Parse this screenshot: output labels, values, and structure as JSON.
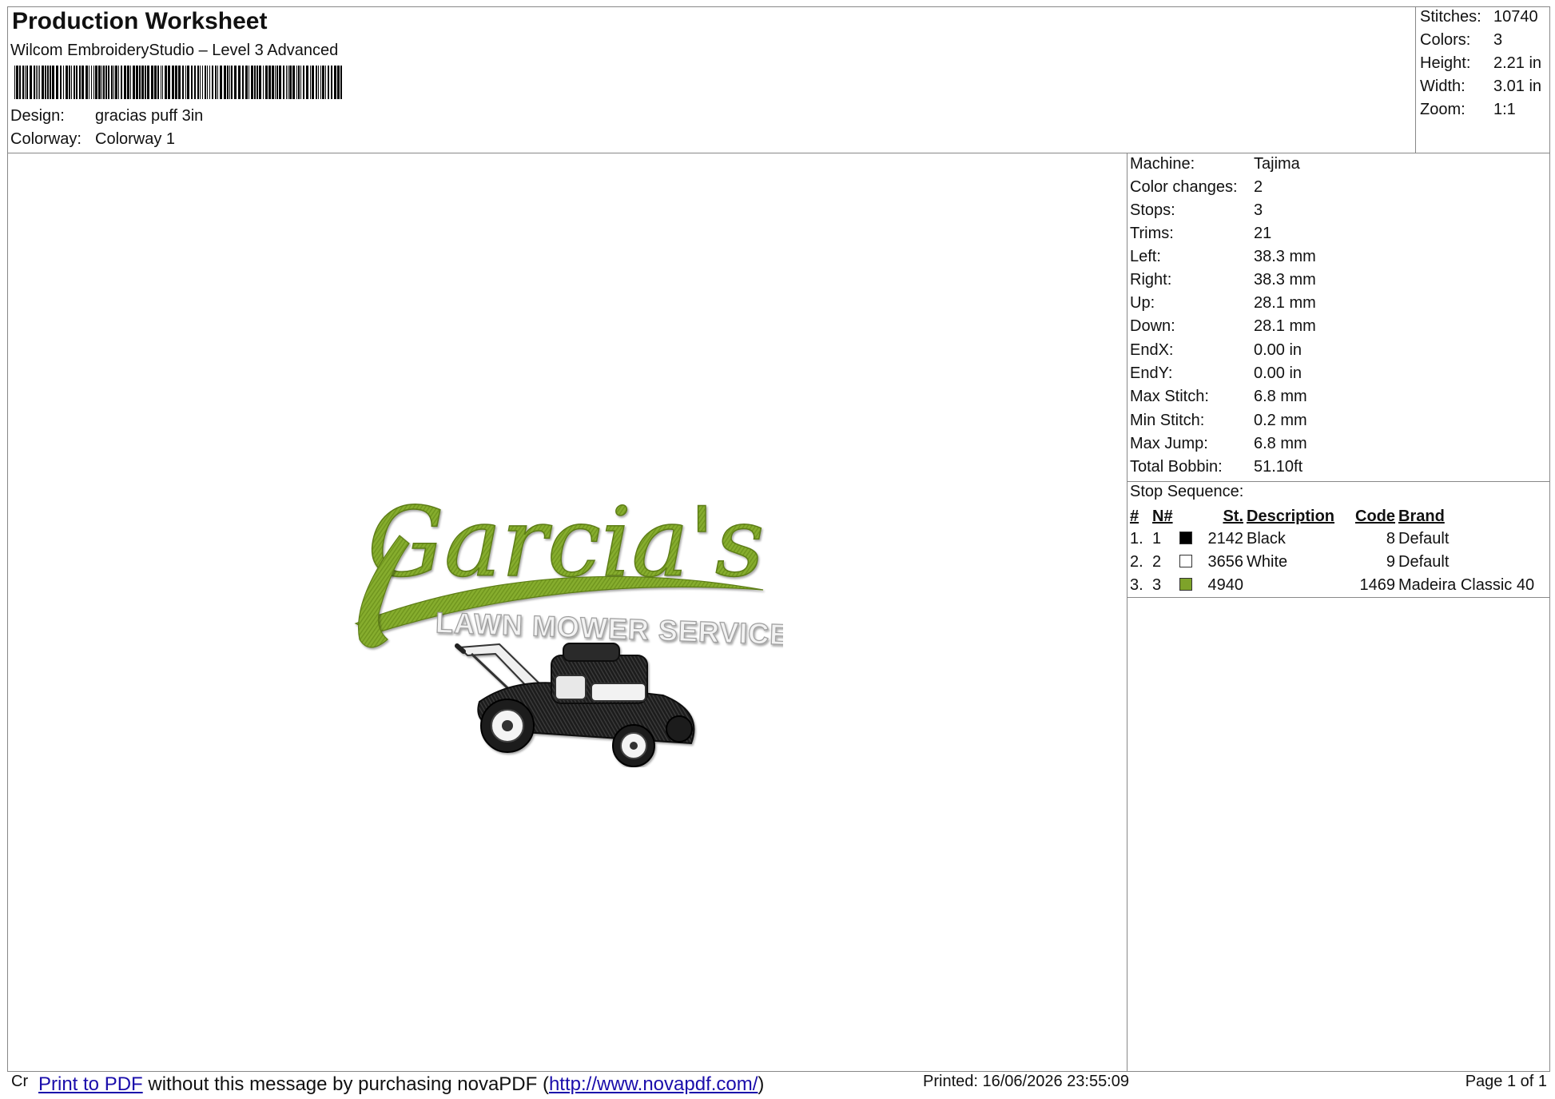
{
  "header": {
    "title": "Production Worksheet",
    "software": "Wilcom EmbroideryStudio – Level 3 Advanced",
    "design_label": "Design:",
    "design_value": "gracias puff 3in",
    "colorway_label": "Colorway:",
    "colorway_value": "Colorway 1"
  },
  "summary": [
    {
      "label": "Stitches:",
      "value": "10740"
    },
    {
      "label": "Colors:",
      "value": "3"
    },
    {
      "label": "Height:",
      "value": "2.21 in"
    },
    {
      "label": "Width:",
      "value": "3.01 in"
    },
    {
      "label": "Zoom:",
      "value": "1:1"
    }
  ],
  "machine_info": [
    {
      "label": "Machine:",
      "value": "Tajima"
    },
    {
      "label": "Color changes:",
      "value": "2"
    },
    {
      "label": "Stops:",
      "value": "3"
    },
    {
      "label": "Trims:",
      "value": "21"
    },
    {
      "label": "Left:",
      "value": "38.3 mm"
    },
    {
      "label": "Right:",
      "value": "38.3 mm"
    },
    {
      "label": "Up:",
      "value": "28.1 mm"
    },
    {
      "label": "Down:",
      "value": "28.1 mm"
    },
    {
      "label": "EndX:",
      "value": "0.00 in"
    },
    {
      "label": "EndY:",
      "value": "0.00 in"
    },
    {
      "label": "Max Stitch:",
      "value": "6.8 mm"
    },
    {
      "label": "Min Stitch:",
      "value": "0.2 mm"
    },
    {
      "label": "Max Jump:",
      "value": "6.8 mm"
    },
    {
      "label": "Total Bobbin:",
      "value": "51.10ft"
    }
  ],
  "stop_sequence": {
    "title": "Stop Sequence:",
    "columns": [
      "#",
      "N#",
      "St.",
      "Description",
      "Code",
      "Brand"
    ],
    "rows": [
      {
        "num": "1.",
        "n": "1",
        "color": "#000000",
        "st": "2142",
        "description": "Black",
        "code": "8",
        "brand": "Default"
      },
      {
        "num": "2.",
        "n": "2",
        "color": "#ffffff",
        "st": "3656",
        "description": "White",
        "code": "9",
        "brand": "Default"
      },
      {
        "num": "3.",
        "n": "3",
        "color": "#7ea32a",
        "st": "4940",
        "description": "",
        "code": "1469",
        "brand": "Madeira Classic 40"
      }
    ]
  },
  "design_art": {
    "script_text": "Garcia's",
    "banner_text": "LAWN MOWER SERVICE",
    "mower_icon": "lawn-mower-icon",
    "green": "#7ea32a",
    "dark_green": "#5d7d18"
  },
  "footer": {
    "cr": "Cr",
    "print_link": "Print to PDF",
    "message": " without this message by purchasing novaPDF (",
    "url": "http://www.novapdf.com/",
    "close": ")",
    "printed": "Printed: 16/06/2026 23:55:09",
    "page": "Page 1 of 1"
  }
}
